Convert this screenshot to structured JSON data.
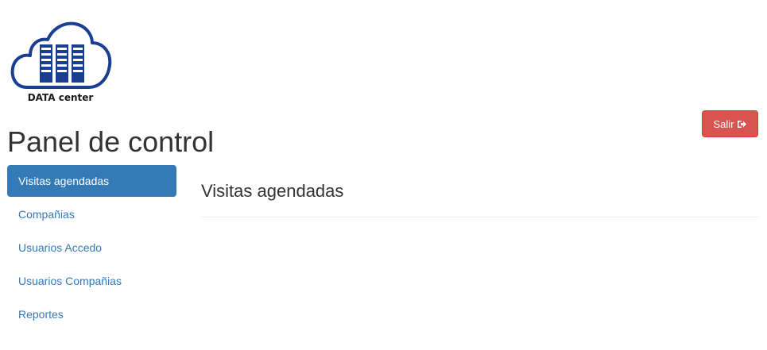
{
  "logo": {
    "text": "DATA center"
  },
  "header": {
    "title": "Panel de control",
    "logout_label": "Salir"
  },
  "sidebar": {
    "items": [
      {
        "label": "Visitas agendadas",
        "active": true
      },
      {
        "label": "Compañias",
        "active": false
      },
      {
        "label": "Usuarios Accedo",
        "active": false
      },
      {
        "label": "Usuarios Compañias",
        "active": false
      },
      {
        "label": "Reportes",
        "active": false
      }
    ]
  },
  "main": {
    "title": "Visitas agendadas"
  },
  "icons": {
    "logo": "cloud-server-icon",
    "logout": "sign-out-icon"
  },
  "colors": {
    "primary": "#337ab7",
    "danger": "#d9534f",
    "logo_blue": "#1a3e91"
  }
}
